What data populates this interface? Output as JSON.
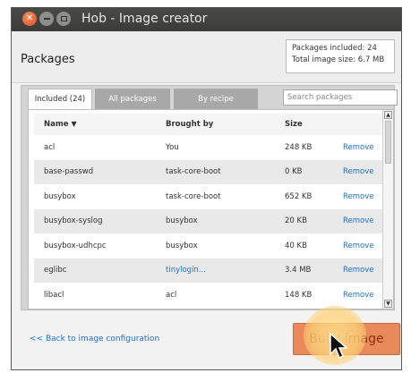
{
  "window": {
    "title": "Hob - Image creator"
  },
  "header": {
    "title": "Packages",
    "summary": {
      "packages_included": "Packages included: 24",
      "total_size": "Total image size:  6.7 MB"
    }
  },
  "tabs": [
    {
      "label": "Included (24)"
    },
    {
      "label": "All packages"
    },
    {
      "label": "By recipe"
    }
  ],
  "search": {
    "placeholder": "Search packages"
  },
  "table": {
    "headers": {
      "name": "Name",
      "brought_by": "Brought by",
      "size": "Size"
    },
    "rows": [
      {
        "name": "acl",
        "brought_by": "You",
        "size": "248 KB",
        "action": "Remove"
      },
      {
        "name": "base-passwd",
        "brought_by": "task-core-boot",
        "size": "0 KB",
        "action": "Remove"
      },
      {
        "name": "busybox",
        "brought_by": "task-core-boot",
        "size": "652 KB",
        "action": "Remove"
      },
      {
        "name": "busybox-syslog",
        "brought_by": "busybox",
        "size": "20 KB",
        "action": "Remove"
      },
      {
        "name": "busybox-udhcpc",
        "brought_by": "busybox",
        "size": "40 KB",
        "action": "Remove"
      },
      {
        "name": "eglibc",
        "brought_by": "tinylogin...",
        "size": "3.4 MB",
        "action": "Remove"
      },
      {
        "name": "libacl",
        "brought_by": "acl",
        "size": "148 KB",
        "action": "Remove"
      }
    ]
  },
  "footer": {
    "back_link": "<< Back to image configuration",
    "build_button": "Build image"
  },
  "colors": {
    "accent": "#e88a5c",
    "link": "#1f6fc7",
    "titlebar": "#3b3b38"
  }
}
